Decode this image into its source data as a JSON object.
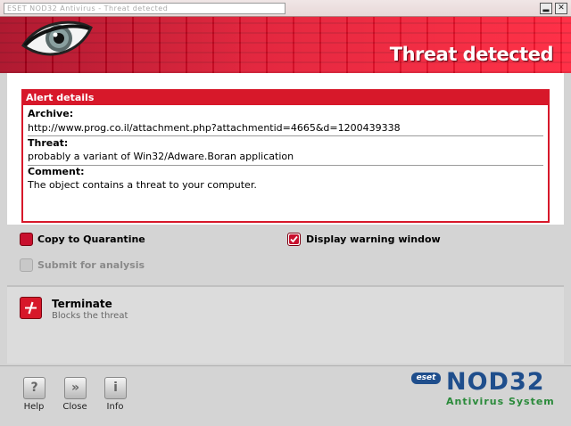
{
  "window": {
    "title": "ESET NOD32 Antivirus - Threat detected",
    "minimize_glyph": "▂",
    "close_glyph": "✕"
  },
  "header": {
    "title": "Threat detected",
    "logo_icon": "eye-icon",
    "brand_color": "#d7182a"
  },
  "alert": {
    "heading": "Alert details",
    "archive_label": "Archive:",
    "archive_value": "http://www.prog.co.il/attachment.php?attachmentid=4665&d=1200439338",
    "threat_label": "Threat:",
    "threat_value": "probably a variant of Win32/Adware.Boran application",
    "comment_label": "Comment:",
    "comment_value": "The object contains a threat to your computer."
  },
  "options": {
    "copy_to_quarantine": {
      "label": "Copy to Quarantine",
      "checked": false
    },
    "display_warning": {
      "label": "Display warning window",
      "checked": true
    },
    "submit_analysis": {
      "label": "Submit for analysis",
      "enabled": false
    }
  },
  "action": {
    "label": "Terminate",
    "description": "Blocks the threat",
    "icon": "terminate-icon"
  },
  "footer": {
    "help_label": "Help",
    "help_glyph": "?",
    "close_label": "Close",
    "close_glyph": "»",
    "info_label": "Info",
    "info_glyph": "i"
  },
  "brand": {
    "eset": "eset",
    "product": "NOD32",
    "tagline": "Antivirus System",
    "product_color": "#1f4e8c",
    "tagline_color": "#2a8a3a"
  }
}
